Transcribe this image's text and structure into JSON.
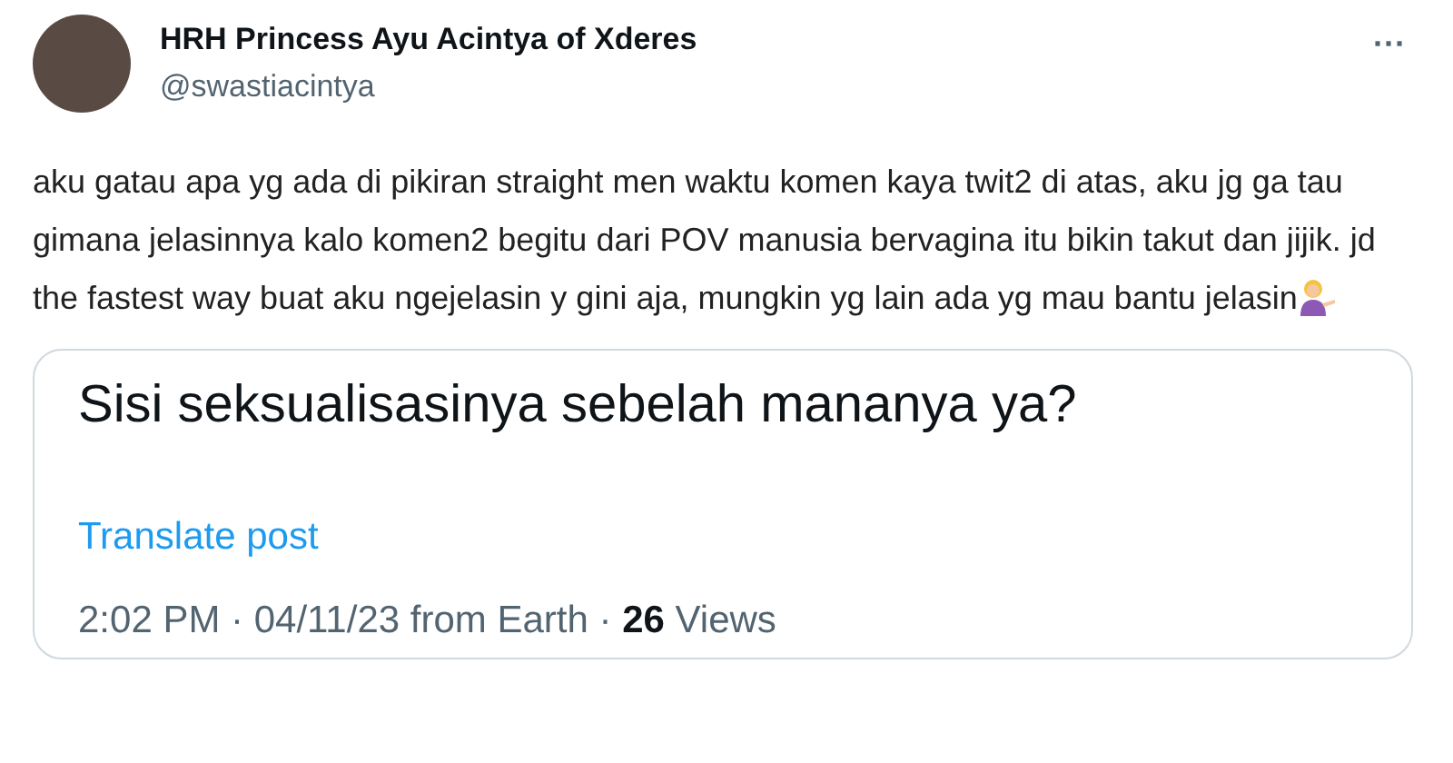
{
  "author": {
    "name": "HRH Princess Ayu Acintya of Xderes",
    "handle": "@swastiacintya"
  },
  "more_button": "···",
  "post_text": "aku gatau apa yg ada di pikiran straight men waktu komen kaya twit2 di atas, aku jg ga tau gimana jelasinnya kalo komen2 begitu dari POV manusia bervagina itu bikin takut dan jijik. jd the fastest way buat aku ngejelasin y gini aja, mungkin yg lain ada yg mau bantu jelasin",
  "quoted_post": {
    "text": "Sisi seksualisasinya sebelah mananya ya?",
    "translate": "Translate post",
    "meta": {
      "time": "2:02 PM · 04/11/23 from Earth · ",
      "views_count": "26",
      "views_label": " Views"
    }
  }
}
